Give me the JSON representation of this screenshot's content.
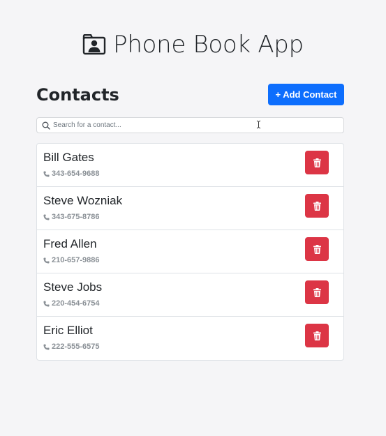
{
  "app": {
    "title": "Phone Book App",
    "logo_icon": "address-book-icon"
  },
  "contacts_section": {
    "heading": "Contacts",
    "add_button_label": "+ Add Contact",
    "search_placeholder": "Search for a contact...",
    "search_value": ""
  },
  "contacts": [
    {
      "name": "Bill Gates",
      "phone": "343-654-9688"
    },
    {
      "name": "Steve Wozniak",
      "phone": "343-675-8786"
    },
    {
      "name": "Fred Allen",
      "phone": "210-657-9886"
    },
    {
      "name": "Steve Jobs",
      "phone": "220-454-6754"
    },
    {
      "name": "Eric Elliot",
      "phone": "222-555-6575"
    }
  ],
  "colors": {
    "primary": "#0d6efd",
    "danger": "#dc3545",
    "muted_text": "#8a9096",
    "background": "#f5f5f7"
  },
  "icons": {
    "search": "search-icon",
    "phone": "phone-icon",
    "delete": "trash-icon"
  }
}
